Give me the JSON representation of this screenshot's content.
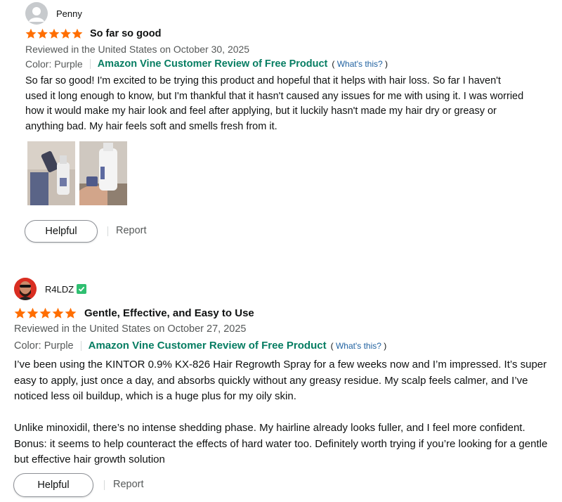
{
  "reviews": [
    {
      "reviewer": "Penny",
      "avatar": "default-avatar-icon",
      "verified": false,
      "rating": 5,
      "title": "So far so good",
      "meta": "Reviewed in the United States on October 30, 2025",
      "format": "Color: Purple",
      "vine_label": "Amazon Vine Customer Review of Free Product",
      "whats_this": "What's this?",
      "body": "So far so good! I'm excited to be trying this product and hopeful that it helps with hair loss. So far I haven't used it long enough to know, but I'm thankful that it hasn't caused any issues for me with using it. I was worried how it would make my hair look and feel after applying, but it luckily hasn't made my hair dry or greasy or anything bad. My hair feels soft and smells fresh from it.",
      "images": [
        "review-photo-product-on-counter",
        "review-photo-bottle-in-hand"
      ],
      "helpful_label": "Helpful",
      "report_label": "Report"
    },
    {
      "reviewer": "R4LDZ",
      "avatar": "bearded-man-avatar-icon",
      "verified": true,
      "rating": 5,
      "title": "Gentle, Effective, and Easy to Use",
      "meta": "Reviewed in the United States on October 27, 2025",
      "format": "Color: Purple",
      "vine_label": "Amazon Vine Customer Review of Free Product",
      "whats_this": "What's this?",
      "body_paragraphs": [
        "I’ve been using the KINTOR 0.9% KX-826 Hair Regrowth Spray for a few weeks now and I’m impressed. It’s super easy to apply, just once a day, and absorbs quickly without any greasy residue. My scalp feels calmer, and I’ve noticed less oil buildup, which is a huge plus for my oily skin.",
        "Unlike minoxidil, there’s no intense shedding phase. My hairline already looks fuller, and I feel more confident. Bonus: it seems to help counteract the effects of hard water too. Definitely worth trying if you’re looking for a gentle but effective hair growth solution"
      ],
      "helpful_label": "Helpful",
      "report_label": "Report"
    }
  ],
  "colors": {
    "star": "#FF6E00",
    "vine_green": "#067D62",
    "link_blue": "#2162A1",
    "meta_gray": "#565959",
    "verified_green": "#2FBF71"
  }
}
